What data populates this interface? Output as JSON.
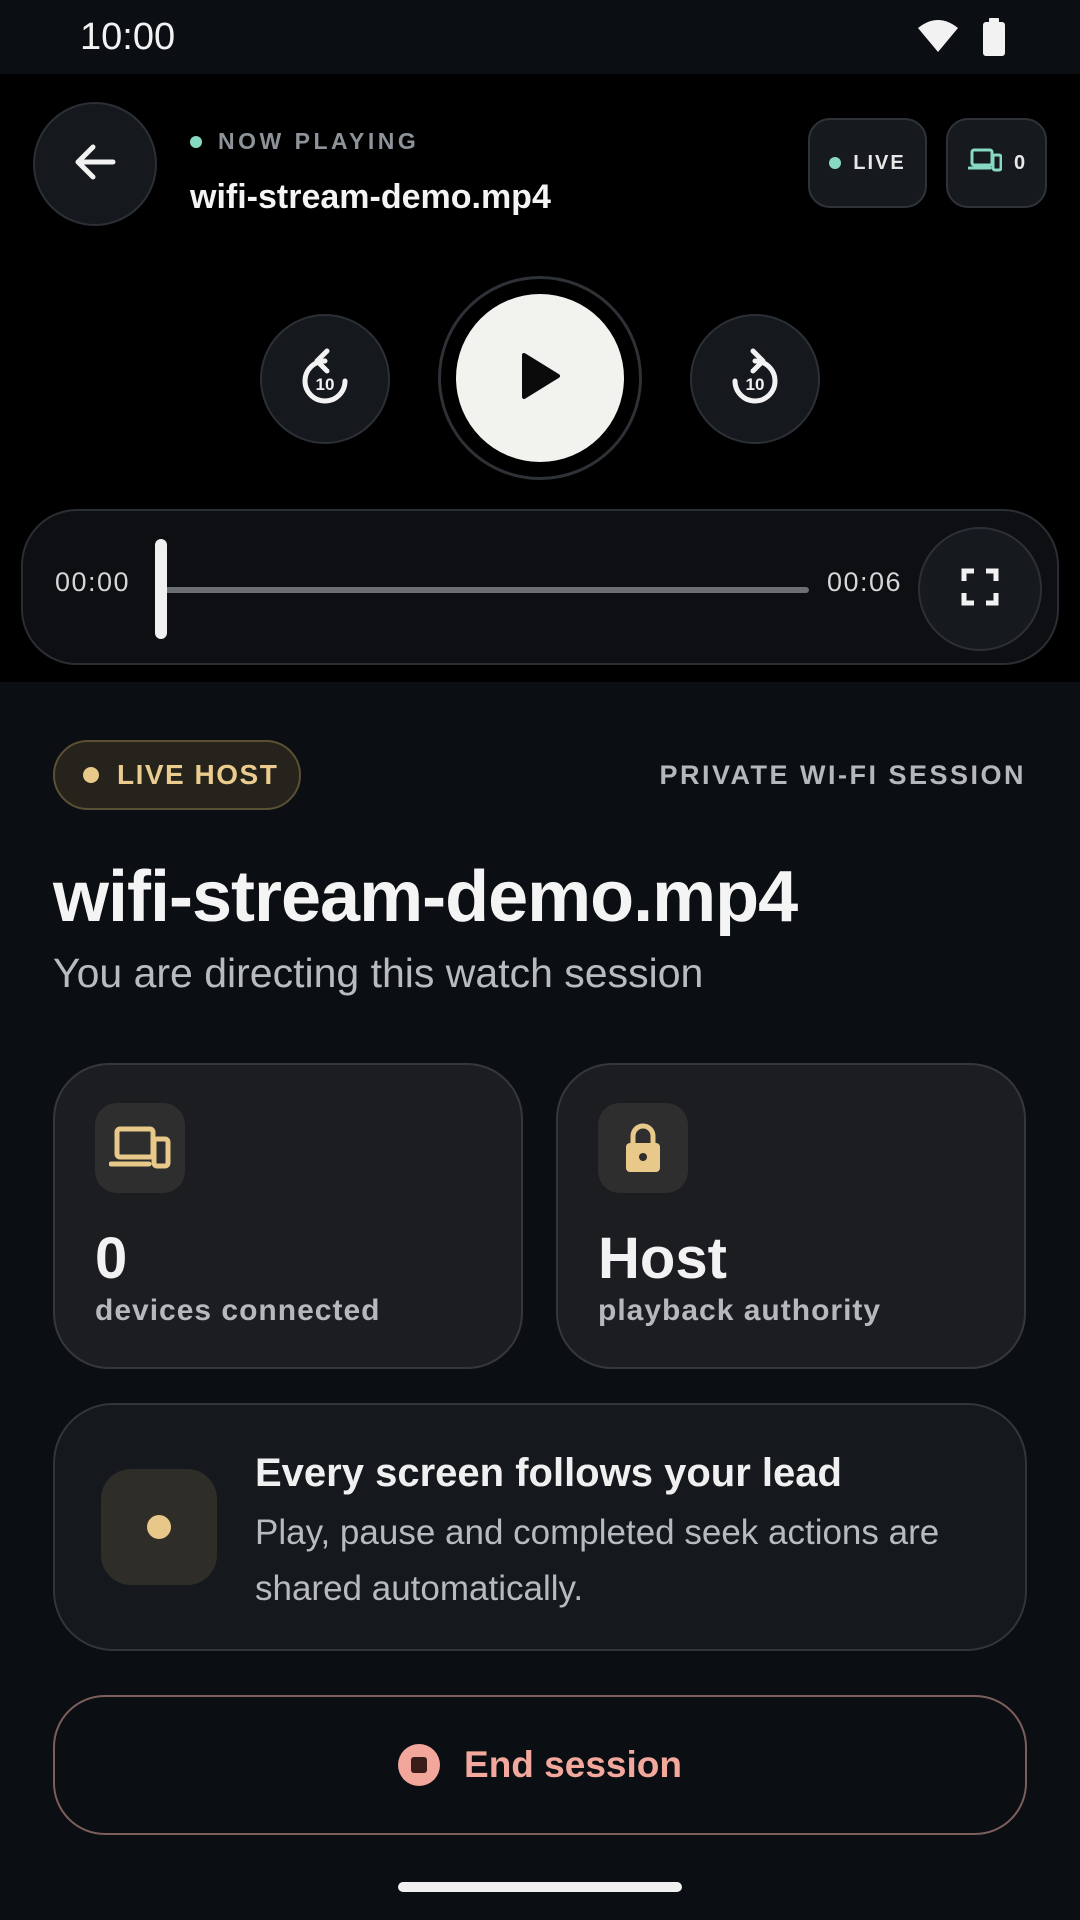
{
  "status_bar": {
    "time": "10:00",
    "icons": [
      "wifi-icon",
      "battery-icon"
    ]
  },
  "player": {
    "now_playing_label": "NOW PLAYING",
    "filename": "wifi-stream-demo.mp4",
    "live_chip_label": "LIVE",
    "device_count": "0",
    "skip_seconds": "10",
    "current_time": "00:00",
    "total_time": "00:06",
    "progress": 0,
    "icons": {
      "back": "arrow-left-icon",
      "rewind": "replay-10-icon",
      "play": "play-icon",
      "forward": "forward-10-icon",
      "fullscreen": "fullscreen-icon",
      "devices": "devices-icon"
    }
  },
  "session": {
    "badge": "LIVE HOST",
    "type": "PRIVATE WI-FI SESSION",
    "title": "wifi-stream-demo.mp4",
    "subtitle": "You are directing this watch session",
    "stats": [
      {
        "icon": "devices-icon",
        "value": "0",
        "label": "devices connected"
      },
      {
        "icon": "lock-icon",
        "value": "Host",
        "label": "playback authority"
      }
    ],
    "lead": {
      "title": "Every screen follows your lead",
      "body": "Play, pause and completed seek actions are shared automatically."
    },
    "end_button": "End session"
  },
  "colors": {
    "background": "#0b0e13",
    "accent_teal": "#87d9c1",
    "accent_gold": "#e9c98a",
    "danger": "#f2a89c"
  }
}
